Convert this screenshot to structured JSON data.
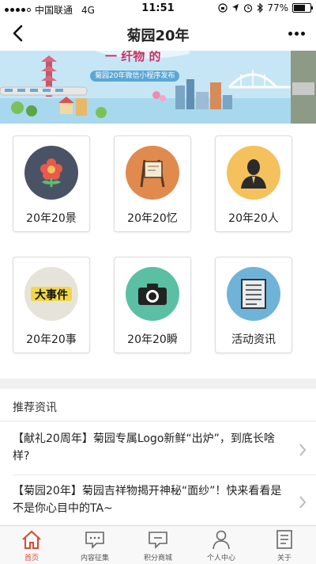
{
  "statusbar": {
    "carrier": "中国联通",
    "network": "4G",
    "time": "11:51",
    "battery_text": "77%",
    "battery_level": 0.77
  },
  "header": {
    "title": "菊园20年"
  },
  "banner": {
    "caption": "菊园20年微信小程序发布"
  },
  "grid": {
    "items": [
      {
        "label": "20年20景",
        "icon": "flower-icon",
        "color": "#4a5266"
      },
      {
        "label": "20年20忆",
        "icon": "easel-icon",
        "color": "#e08a4e"
      },
      {
        "label": "20年20人",
        "icon": "person-icon",
        "color": "#f5c15c"
      },
      {
        "label": "20年20事",
        "icon": "big-event-icon",
        "color": "#e6e4da"
      },
      {
        "label": "20年20瞬",
        "icon": "camera-icon",
        "color": "#5bbfa4"
      },
      {
        "label": "活动资讯",
        "icon": "newspaper-icon",
        "color": "#6fb3d9"
      }
    ]
  },
  "recommended": {
    "header": "推荐资讯",
    "items": [
      {
        "text": "【献礼20周年】菊园专属Logo新鲜“出炉”，到底长啥样?"
      },
      {
        "text": "【菊园20年】菊园吉祥物揭开神秘“面纱”！快来看看是不是你心目中的TA~"
      }
    ]
  },
  "tabbar": {
    "items": [
      {
        "label": "首页",
        "icon": "home-icon",
        "active": true
      },
      {
        "label": "内容征集",
        "icon": "chat-icon",
        "active": false
      },
      {
        "label": "积分商城",
        "icon": "mall-icon",
        "active": false
      },
      {
        "label": "个人中心",
        "icon": "user-icon",
        "active": false
      },
      {
        "label": "关于",
        "icon": "document-icon",
        "active": false
      }
    ]
  },
  "colors": {
    "accent": "#d64a2f",
    "banner_bg": "#bfe3f5"
  }
}
